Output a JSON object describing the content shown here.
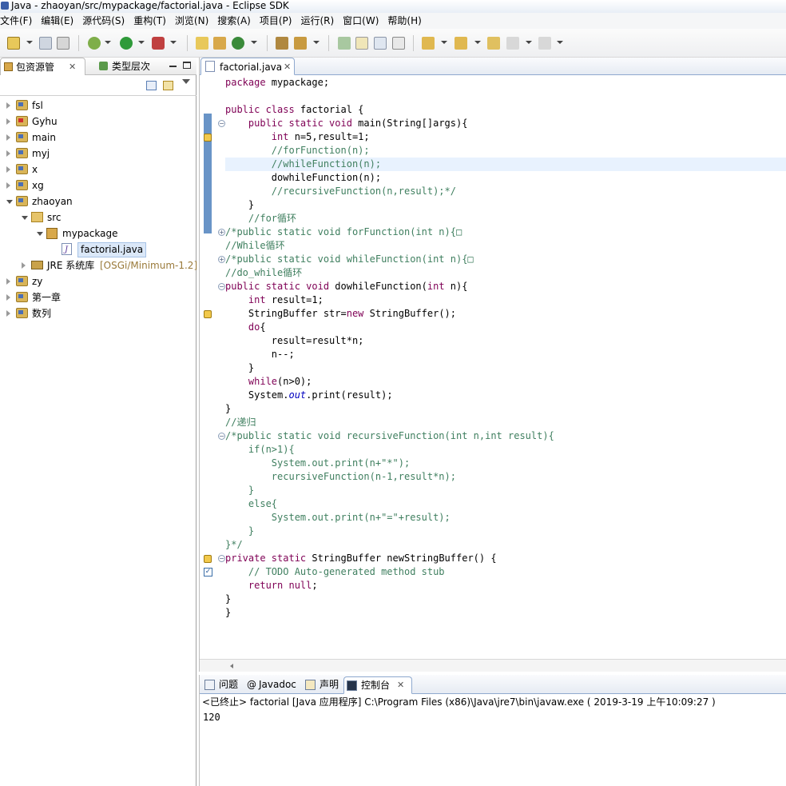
{
  "window": {
    "title": "Java  -  zhaoyan/src/mypackage/factorial.java  -  Eclipse SDK"
  },
  "menu": [
    "文件(F)",
    "编辑(E)",
    "源代码(S)",
    "重构(T)",
    "浏览(N)",
    "搜索(A)",
    "项目(P)",
    "运行(R)",
    "窗口(W)",
    "帮助(H)"
  ],
  "left_panel": {
    "tabs": [
      {
        "label": "包资源管",
        "icon": "package-explorer-icon"
      },
      {
        "label": "类型层次",
        "icon": "type-hierarchy-icon"
      }
    ],
    "tree": [
      {
        "label": "fsl",
        "kind": "project",
        "level": 0,
        "expanded": false
      },
      {
        "label": "Gyhu",
        "kind": "project-error",
        "level": 0,
        "expanded": false
      },
      {
        "label": "main",
        "kind": "project",
        "level": 0,
        "expanded": false
      },
      {
        "label": "myj",
        "kind": "project",
        "level": 0,
        "expanded": false
      },
      {
        "label": "x",
        "kind": "project",
        "level": 0,
        "expanded": false
      },
      {
        "label": "xg",
        "kind": "project",
        "level": 0,
        "expanded": false
      },
      {
        "label": "zhaoyan",
        "kind": "project",
        "level": 0,
        "expanded": true
      },
      {
        "label": "src",
        "kind": "source-folder",
        "level": 1,
        "expanded": true
      },
      {
        "label": "mypackage",
        "kind": "package",
        "level": 2,
        "expanded": true
      },
      {
        "label": "factorial.java",
        "kind": "java-file",
        "level": 3,
        "expanded": false,
        "selected": true
      },
      {
        "label": "JRE 系统库",
        "decor": "[OSGi/Minimum-1.2]",
        "kind": "jre-library",
        "level": 1,
        "expanded": false
      },
      {
        "label": "zy",
        "kind": "project",
        "level": 0,
        "expanded": false
      },
      {
        "label": "第一章",
        "kind": "project",
        "level": 0,
        "expanded": false
      },
      {
        "label": "数列",
        "kind": "project",
        "level": 0,
        "expanded": false
      }
    ]
  },
  "editor": {
    "tab_label": "factorial.java",
    "lines": [
      [
        [
          "kw",
          "package"
        ],
        [
          "t",
          " mypackage;"
        ]
      ],
      [],
      [
        [
          "kw",
          "public class"
        ],
        [
          "t",
          " factorial {"
        ]
      ],
      [
        [
          "t",
          "    "
        ],
        [
          "kw",
          "public static void"
        ],
        [
          "t",
          " main(String[]args){"
        ]
      ],
      [
        [
          "t",
          "        "
        ],
        [
          "kw",
          "int"
        ],
        [
          "t",
          " n=5,result=1;"
        ]
      ],
      [
        [
          "cm",
          "        //forFunction(n);"
        ]
      ],
      [
        [
          "cm",
          "        //whileFunction(n);"
        ]
      ],
      [
        [
          "t",
          "        dowhileFunction(n);"
        ]
      ],
      [
        [
          "cm",
          "        //recursiveFunction(n,result);*/"
        ]
      ],
      [
        [
          "t",
          "    }"
        ]
      ],
      [
        [
          "cm",
          "    //for循环"
        ]
      ],
      [
        [
          "cm",
          "/*public static void forFunction(int n){□"
        ]
      ],
      [
        [
          "cm",
          "//While循环"
        ]
      ],
      [
        [
          "cm",
          "/*public static void whileFunction(int n){□"
        ]
      ],
      [
        [
          "cm",
          "//do_while循环"
        ]
      ],
      [
        [
          "kw",
          "public static void"
        ],
        [
          "t",
          " dowhileFunction("
        ],
        [
          "kw",
          "int"
        ],
        [
          "t",
          " n){"
        ]
      ],
      [
        [
          "t",
          "    "
        ],
        [
          "kw",
          "int"
        ],
        [
          "t",
          " result=1;"
        ]
      ],
      [
        [
          "t",
          "    StringBuffer str="
        ],
        [
          "kw",
          "new"
        ],
        [
          "t",
          " StringBuffer();"
        ]
      ],
      [
        [
          "t",
          "    "
        ],
        [
          "kw",
          "do"
        ],
        [
          "t",
          "{"
        ]
      ],
      [
        [
          "t",
          "        result=result*n;"
        ]
      ],
      [
        [
          "t",
          "        n--;"
        ]
      ],
      [
        [
          "t",
          "    }"
        ]
      ],
      [
        [
          "t",
          "    "
        ],
        [
          "kw",
          "while"
        ],
        [
          "t",
          "(n>0);"
        ]
      ],
      [
        [
          "t",
          "    System."
        ],
        [
          "fld",
          "out"
        ],
        [
          "t",
          ".print(result);"
        ]
      ],
      [
        [
          "t",
          "}"
        ]
      ],
      [
        [
          "cm",
          "//递归"
        ]
      ],
      [
        [
          "cm",
          "/*public static void recursiveFunction(int n,int result){"
        ]
      ],
      [
        [
          "cm",
          "    if(n>1){"
        ]
      ],
      [
        [
          "cm",
          "        System.out.print(n+\"*\");"
        ]
      ],
      [
        [
          "cm",
          "        recursiveFunction(n-1,result*n);"
        ]
      ],
      [
        [
          "cm",
          "    }"
        ]
      ],
      [
        [
          "cm",
          "    else{"
        ]
      ],
      [
        [
          "cm",
          "        System.out.print(n+\"=\"+result);"
        ]
      ],
      [
        [
          "cm",
          "    }"
        ]
      ],
      [
        [
          "cm",
          "}*/"
        ]
      ],
      [
        [
          "kw",
          "private static"
        ],
        [
          "t",
          " StringBuffer newStringBuffer() {"
        ]
      ],
      [
        [
          "cm",
          "    // TODO Auto-generated method stub"
        ]
      ],
      [
        [
          "t",
          "    "
        ],
        [
          "kw",
          "return null"
        ],
        [
          "t",
          ";"
        ]
      ],
      [
        [
          "t",
          "}"
        ]
      ],
      [
        [
          "t",
          "}"
        ]
      ]
    ],
    "current_line": 6
  },
  "bottom_panel": {
    "tabs": [
      {
        "label": "问题",
        "icon": "problems-icon"
      },
      {
        "label": "Javadoc",
        "icon": "javadoc-icon"
      },
      {
        "label": "声明",
        "icon": "declaration-icon"
      },
      {
        "label": "控制台",
        "icon": "console-icon",
        "active": true
      }
    ],
    "console_status": "<已终止> factorial [Java 应用程序] C:\\Program Files (x86)\\Java\\jre7\\bin\\javaw.exe ( 2019-3-19 上午10:09:27 )",
    "console_output": "120"
  }
}
